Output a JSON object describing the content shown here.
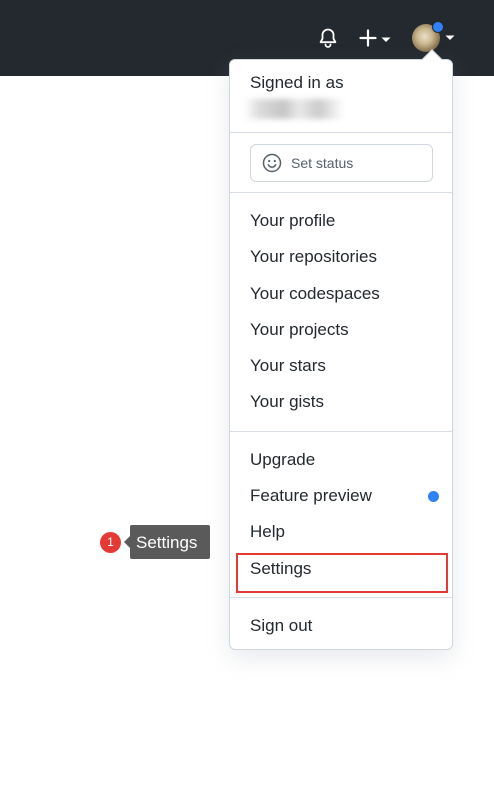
{
  "header": {
    "icons": [
      "bell-icon",
      "plus-icon",
      "chevron-down-icon"
    ],
    "avatar_badge_color": "#2f81f7"
  },
  "user_menu": {
    "signed_in_label": "Signed in as",
    "status_button_label": "Set status",
    "section_profile": [
      {
        "label": "Your profile"
      },
      {
        "label": "Your repositories"
      },
      {
        "label": "Your codespaces"
      },
      {
        "label": "Your projects"
      },
      {
        "label": "Your stars"
      },
      {
        "label": "Your gists"
      }
    ],
    "section_account": [
      {
        "label": "Upgrade"
      },
      {
        "label": "Feature preview"
      },
      {
        "label": "Help"
      },
      {
        "label": "Settings"
      }
    ],
    "sign_out_label": "Sign out"
  },
  "annotation": {
    "step_number": "1",
    "tooltip_text": "Settings",
    "highlight_color": "#e53935"
  }
}
